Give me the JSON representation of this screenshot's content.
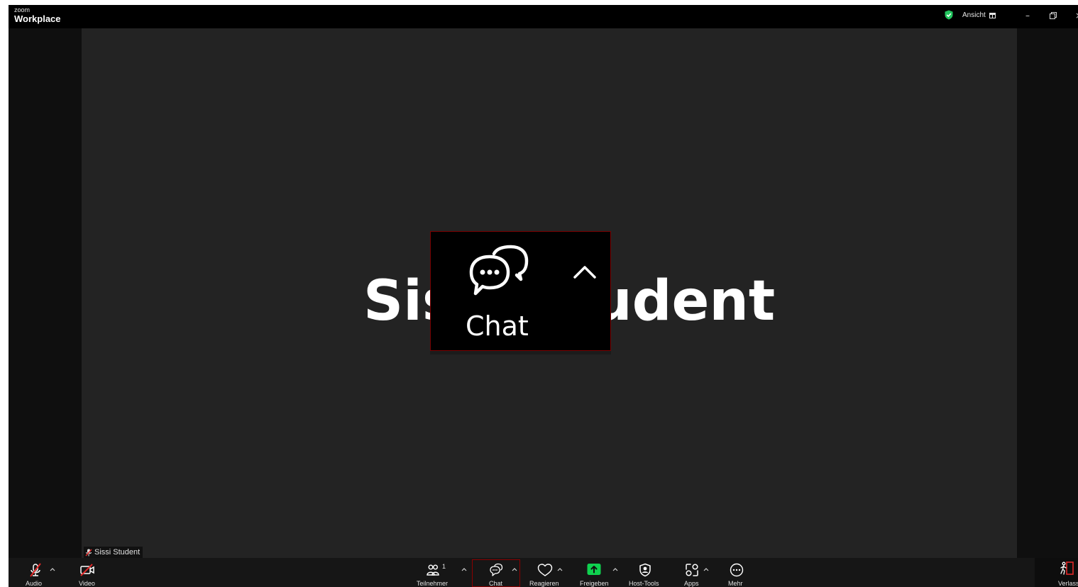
{
  "app": {
    "brand_small": "zoom",
    "brand_title": "Workplace",
    "view_label": "Ansicht"
  },
  "colors": {
    "background": "#232323",
    "toolbar": "#161616",
    "share_green": "#0fd14f",
    "mute_red": "#e02828",
    "shield_green": "#22c55e",
    "highlight_frame": "#8b0000"
  },
  "meeting": {
    "participant_display_name": "Sissi Student",
    "name_tag": "Sissi Student"
  },
  "zoom_overlay": {
    "chat_label": "Chat",
    "icon": "chat-bubbles-icon"
  },
  "toolbar": {
    "audio_label": "Audio",
    "video_label": "Video",
    "participants_label": "Teilnehmer",
    "participants_count": "1",
    "chat_label": "Chat",
    "react_label": "Reagieren",
    "share_label": "Freigeben",
    "host_tools_label": "Host-Tools",
    "apps_label": "Apps",
    "more_label": "Mehr",
    "leave_label": "Verlassen"
  }
}
